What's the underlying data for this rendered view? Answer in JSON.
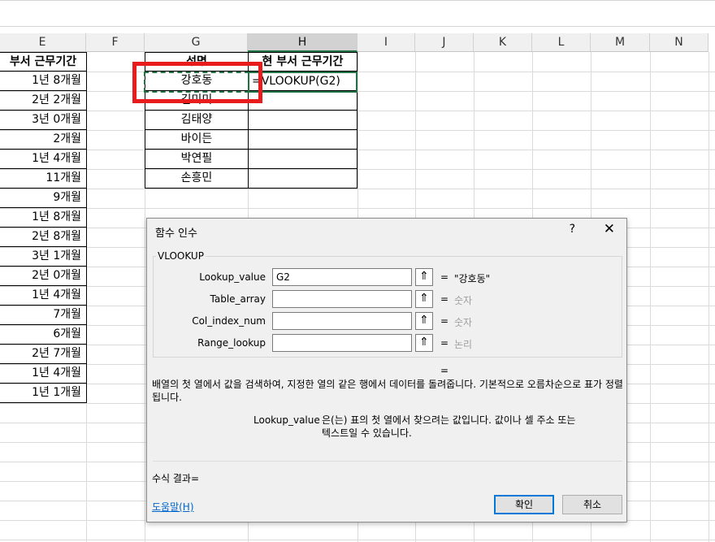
{
  "columns": [
    "E",
    "F",
    "G",
    "H",
    "I",
    "J",
    "K",
    "L",
    "M",
    "N"
  ],
  "col_e": {
    "header": "부서 근무기간",
    "values": [
      "1년 8개월",
      "2년 2개월",
      "3년 0개월",
      "2개월",
      "1년 4개월",
      "11개월",
      "9개월",
      "1년 8개월",
      "2년 8개월",
      "3년 1개월",
      "2년 0개월",
      "1년 4개월",
      "7개월",
      "6개월",
      "2년 7개월",
      "1년 4개월",
      "1년 1개월"
    ]
  },
  "col_g": {
    "header": "성명",
    "values": [
      "강호동",
      "김미미",
      "김태양",
      "바이든",
      "박연필",
      "손흥민"
    ]
  },
  "col_h": {
    "header": "현 부서 근무기간",
    "formula": "=VLOOKUP(G2)"
  },
  "dialog": {
    "title": "함수 인수",
    "help": "?",
    "close": "✕",
    "function_name": "VLOOKUP",
    "args": [
      {
        "label": "Lookup_value",
        "value": "G2",
        "result": "\"강호동\"",
        "result_dim": false
      },
      {
        "label": "Table_array",
        "value": "",
        "result": "숫자",
        "result_dim": true
      },
      {
        "label": "Col_index_num",
        "value": "",
        "result": "숫자",
        "result_dim": true
      },
      {
        "label": "Range_lookup",
        "value": "",
        "result": "논리",
        "result_dim": true
      }
    ],
    "equals": "=",
    "overall_eq": "=",
    "description": "배열의 첫 열에서 값을 검색하여, 지정한 열의 같은 행에서 데이터를 돌려줍니다. 기본적으로 오름차순으로 표가 정렬됩니다.",
    "arg_name": "Lookup_value",
    "arg_description_line1": "은(는) 표의 첫 열에서 찾으려는 값입니다. 값이나 셀 주소 또는",
    "arg_description_line2": "텍스트일 수 있습니다.",
    "formula_result": "수식 결과=",
    "help_link": "도움말(H)",
    "ok": "확인",
    "cancel": "취소"
  }
}
